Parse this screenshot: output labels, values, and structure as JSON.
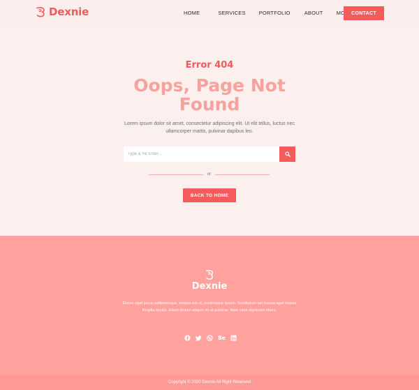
{
  "brand": {
    "name": "Dexnie",
    "accent": "#f45c5c",
    "title_pink": "#f9a29d",
    "footer_bg": "#ffa29e"
  },
  "nav": {
    "items": [
      {
        "label": "HOME"
      },
      {
        "label": "SERVICES"
      },
      {
        "label": "PORTFOLIO"
      },
      {
        "label": "ABOUT"
      },
      {
        "label": "MORE"
      }
    ],
    "contact_label": "CONTACT"
  },
  "error": {
    "code": "Error 404",
    "title": "Oops, Page Not Found",
    "description": "Lorem ipsum dolor sit amet, consectetur adipiscing elit. Ut elit tellus, luctus nec ullamcorper mattis, pulvinar dapibus leo."
  },
  "search": {
    "placeholder": "Type & Hit Enter...",
    "icon": "search-icon"
  },
  "or_text": "or",
  "back_label": "BACK TO HOME",
  "footer": {
    "name": "Dexnie",
    "description": "Donec eget purus pellentesque, tempor est ut, scelerisque ipsum. Vestibulum vel massa eget massa fringilla iaculis. Etiam dictum aliquet mi ut pulvinar. Nam vitae dignissim libero.",
    "socials": [
      "facebook-icon",
      "twitter-icon",
      "dribbble-icon",
      "behance-icon",
      "linkedin-icon"
    ],
    "behance_text": "Be",
    "copyright": "Copyright © 2020 Dexnie All Right Reserved"
  }
}
